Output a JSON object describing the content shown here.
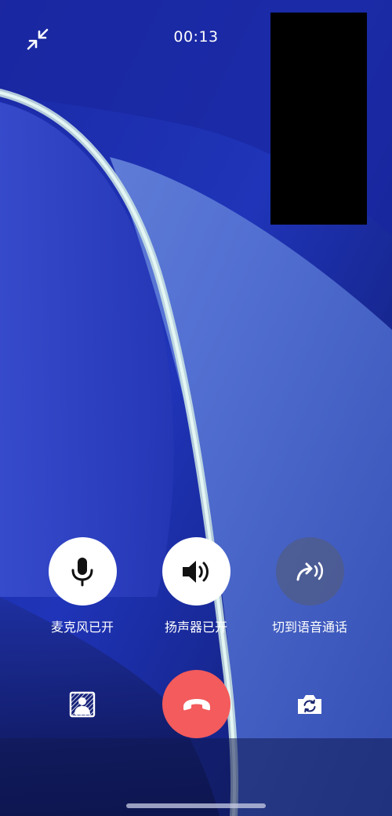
{
  "call": {
    "duration": "00:13",
    "minimize_icon": "minimize-arrows-icon"
  },
  "controls": [
    {
      "label": "麦克风已开",
      "icon": "microphone-icon",
      "state": "on"
    },
    {
      "label": "扬声器已开",
      "icon": "speaker-icon",
      "state": "on"
    },
    {
      "label": "切到语音通话",
      "icon": "switch-to-voice-icon",
      "state": "off"
    }
  ],
  "bottom_bar": {
    "blur_background_icon": "portrait-blur-icon",
    "hangup_icon": "hang-up-icon",
    "switch_camera_icon": "switch-camera-icon"
  },
  "colors": {
    "hangup": "#f35b5c",
    "active_button": "#ffffff",
    "inactive_button": "#505c84",
    "background": "#10196a"
  }
}
